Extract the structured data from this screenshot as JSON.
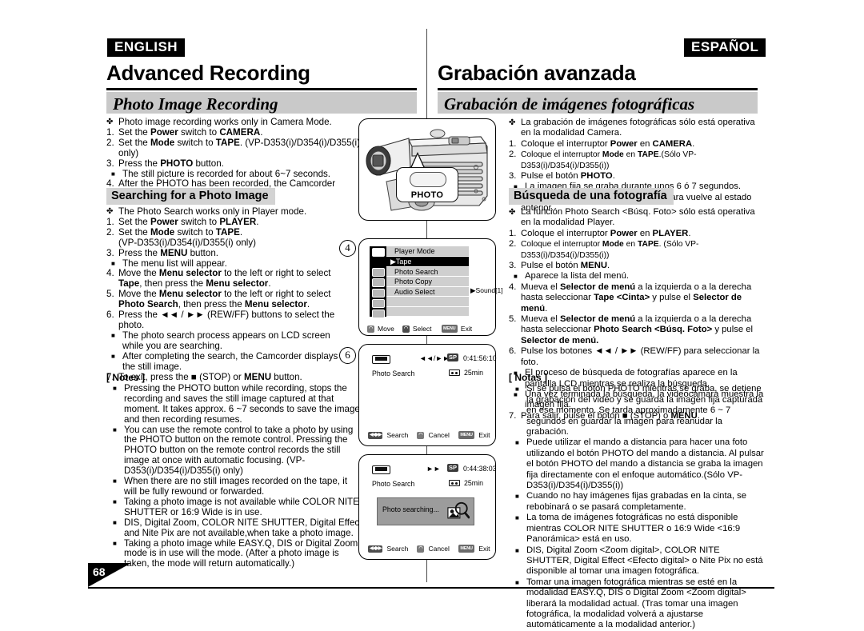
{
  "page_number": "68",
  "english": {
    "badge": "ENGLISH",
    "chapter": "Advanced Recording",
    "section": "Photo Image Recording",
    "intro_clover": "Photo image recording works only in Camera Mode.",
    "steps": [
      {
        "n": "1.",
        "text": "Set the Power switch to CAMERA."
      },
      {
        "n": "2.",
        "text": "Set the Mode switch to TAPE. (VP-D353(i)/D354(i)/D355(i) only)"
      },
      {
        "n": "3.",
        "text": "Press the PHOTO button."
      },
      {
        "n": "",
        "sub": "The still picture is recorded for about 6~7 seconds."
      },
      {
        "n": "4.",
        "text": "After the PHOTO has been recorded, the Camcorder returns to its previous mode."
      }
    ],
    "subhead": "Searching for a Photo Image",
    "search_clover": "The Photo Search works only in Player mode.",
    "search_steps": [
      {
        "n": "1.",
        "text": "Set the Power switch to PLAYER."
      },
      {
        "n": "2.",
        "text": "Set the Mode switch to TAPE."
      },
      {
        "n": "",
        "cont": "(VP-D353(i)/D354(i)/D355(i) only)"
      },
      {
        "n": "3.",
        "text": "Press the MENU button."
      },
      {
        "n": "",
        "sub": "The menu list will appear."
      },
      {
        "n": "4.",
        "text": "Move the Menu selector to the left or right to select Tape, then press the Menu selector."
      },
      {
        "n": "5.",
        "text": "Move the Menu selector to the left or right to select Photo Search, then press the Menu selector."
      },
      {
        "n": "6.",
        "text": "Press the ◄◄ / ►► (REW/FF) buttons to select the photo."
      },
      {
        "n": "",
        "sub": "The photo search process appears on LCD screen while you are searching."
      },
      {
        "n": "",
        "sub": "After completing the search, the Camcorder displays the still image."
      },
      {
        "n": "7.",
        "text": "To exit, press the ■ (STOP) or MENU button."
      }
    ],
    "notes_label": "[ Notes ]",
    "notes": [
      "Pressing the PHOTO button while recording, stops the recording and saves the still image captured at that moment. It takes approx. 6 ~7 seconds to save the image and then recording resumes.",
      "You can use the remote control to take a photo by using the PHOTO button on the remote control. Pressing the PHOTO button on the remote control records the still image at once with automatic focusing. (VP-D353(i)/D354(i)/D355(i) only)",
      "When there are no still images recorded on the tape, it will be fully rewound or forwarded.",
      "Taking a photo image is not available while COLOR NITE SHUTTER or 16:9 Wide is in use.",
      "DIS, Digital Zoom, COLOR NITE SHUTTER, Digital Effect and Nite Pix are not available,when take a photo image.",
      "Taking a photo image while EASY.Q, DIS or Digital Zoom mode is in use will the mode. (After a photo image is taken, the mode will return automatically.)"
    ]
  },
  "spanish": {
    "badge": "ESPAÑOL",
    "chapter": "Grabación avanzada",
    "section": "Grabación de imágenes fotográficas",
    "intro_clover": "La grabación de imágenes fotográficas sólo está operativa en la modalidad Camera.",
    "steps": [
      {
        "n": "1.",
        "text": "Coloque el interruptor Power en CAMERA."
      },
      {
        "n": "2.",
        "text": "Coloque el interruptor Mode en TAPE.(Sólo VP-D353(i)/D354(i)/D355(i))"
      },
      {
        "n": "3.",
        "text": "Pulse el botón PHOTO."
      },
      {
        "n": "",
        "sub": "La imagen fija se graba durante unos 6 ó 7 segundos."
      },
      {
        "n": "4.",
        "text": "Tras grabar la fotografía, la videocámara vuelve al estado anterior."
      }
    ],
    "subhead": "Búsqueda de una fotografía",
    "search_clover": "La función Photo Search <Búsq. Foto> sólo está operativa en la modalidad Player.",
    "search_steps": [
      {
        "n": "1.",
        "text": "Coloque el interruptor Power en PLAYER."
      },
      {
        "n": "2.",
        "text": "Coloque el interruptor Mode en TAPE. (Sólo VP-D353(i)/D354(i)/D355(i))"
      },
      {
        "n": "3.",
        "text": "Pulse el botón MENU."
      },
      {
        "n": "",
        "sub": "Aparece la lista del menú."
      },
      {
        "n": "4.",
        "text": "Mueva el Selector de menú a la izquierda o a la derecha hasta seleccionar Tape <Cinta> y pulse el Selector de menú."
      },
      {
        "n": "5.",
        "text": "Mueva el Selector de menú a la izquierda o a la derecha hasta seleccionar Photo Search <Búsq. Foto> y pulse el Selector de menú."
      },
      {
        "n": "6.",
        "text": "Pulse los botones ◄◄ / ►► (REW/FF) para seleccionar la foto."
      },
      {
        "n": "",
        "sub": "El proceso de búsqueda de fotografías aparece en la pantalla LCD mientras se realiza la búsqueda."
      },
      {
        "n": "",
        "sub": "Una vez terminada la búsqueda, la videocámara muestra la imagen fija."
      },
      {
        "n": "7.",
        "text": "Para salir, pulse el botón ■ (STOP) o MENU."
      }
    ],
    "notes_label": "[ Notas ]",
    "notes": [
      "Si se pulsa el botón PHOTO mientras se graba, se detiene la grabación del video y se guarda la imagen fija capturada en ese momento. Se tarda aproximadamente 6 ~ 7 segundos en guardar la imagen para reanudar la grabación.",
      "Puede utilizar el mando a distancia para hacer una foto utilizando el botón PHOTO del mando a distancia. Al pulsar el botón PHOTO del mando a distancia se graba la imagen fija directamente con el enfoque automático.(Sólo VP-D353(i)/D354(i)/D355(i))",
      "Cuando no hay imágenes fijas grabadas en la cinta, se rebobinará o se pasará completamente.",
      "La toma de imágenes fotográficas no está disponible mientras COLOR NITE SHUTTER o 16:9 Wide <16:9 Panorámica> está en uso.",
      "DIS, Digital Zoom <Zoom digital>, COLOR NITE SHUTTER, Digital Effect <Efecto digital> o Nite Pix no está disponible al tomar una imagen fotográfica.",
      "Tomar una imagen fotográfica mientras se esté en la modalidad EASY.Q, DIS o Digital Zoom <Zoom digital> liberará la modalidad actual. (Tras tomar una imagen fotográfica, la modalidad volverá a ajustarse automáticamente a la modalidad anterior.)"
    ]
  },
  "illustrations": {
    "step_markers": {
      "four": "4",
      "six": "6"
    },
    "camcorder": {
      "button_label": "PHOTO"
    },
    "menu_screen": {
      "title": "Player Mode",
      "items": [
        "Tape",
        "Photo Search",
        "Photo Copy",
        "Audio Select"
      ],
      "selected_item": "Tape",
      "submenu_value": "Sound[1]",
      "hints": [
        {
          "key": "move-key",
          "label": "Move"
        },
        {
          "key": "select-key",
          "label": "Select"
        },
        {
          "key": "MENU",
          "label": "Exit"
        }
      ]
    },
    "search_screen_1": {
      "mode": "SP",
      "transport": "◄◄/►►",
      "timecode": "0:41:56:10",
      "status": "Photo Search",
      "tape_remaining": "25min",
      "hints": [
        {
          "key": "◄◄►►",
          "label": "Search"
        },
        {
          "key": "cancel-key",
          "label": "Cancel"
        },
        {
          "key": "MENU",
          "label": "Exit"
        }
      ]
    },
    "search_screen_2": {
      "mode": "SP",
      "transport": "►►",
      "timecode": "0:44:38:03",
      "status": "Photo Search",
      "tape_remaining": "25min",
      "dialog": "Photo searching...",
      "hints": [
        {
          "key": "◄◄►►",
          "label": "Search"
        },
        {
          "key": "cancel-key",
          "label": "Cancel"
        },
        {
          "key": "MENU",
          "label": "Exit"
        }
      ]
    }
  },
  "colors": {
    "section_bar": "#c9c9c9",
    "subhead_bar": "#d3d3d3",
    "badge_bg": "#000000",
    "lcd_menu_bg": "#cfcfcf",
    "dialog_bg": "#9c9c9c"
  }
}
